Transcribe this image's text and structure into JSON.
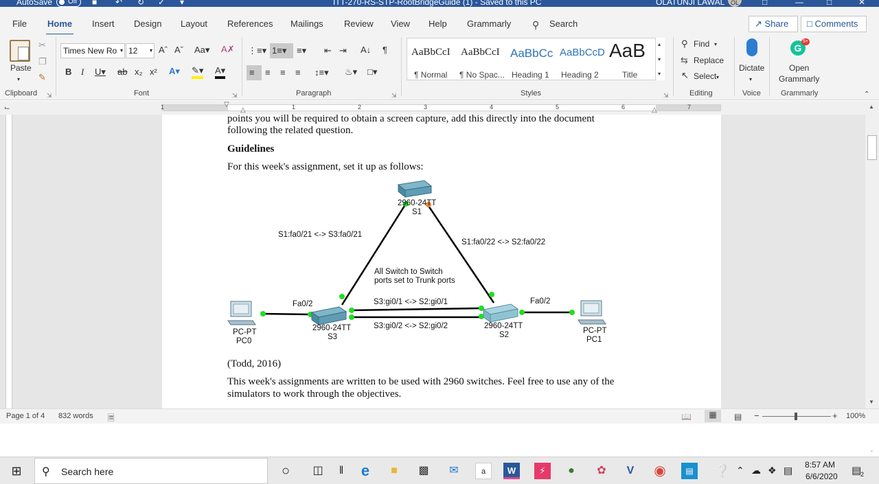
{
  "titlebar": {
    "autosave_label": "AutoSave",
    "autosave_state": "Off",
    "doc_title": "ITT-270-RS-STP-RootBridgeGuide (1)  -  Saved to this PC",
    "user_name": "OLATUNJI LAWAL",
    "user_initials": "OL"
  },
  "tabs": [
    "File",
    "Home",
    "Insert",
    "Design",
    "Layout",
    "References",
    "Mailings",
    "Review",
    "View",
    "Help",
    "Grammarly"
  ],
  "search": {
    "label": "Search"
  },
  "share_label": "Share",
  "comments_label": "Comments",
  "ribbon": {
    "clipboard": {
      "paste_label": "Paste",
      "group_label": "Clipboard"
    },
    "font": {
      "font_name": "Times New Ro",
      "font_size": "12",
      "group_label": "Font"
    },
    "paragraph": {
      "group_label": "Paragraph"
    },
    "styles": {
      "group_label": "Styles",
      "items": [
        {
          "preview": "AaBbCcI",
          "name": "¶ Normal"
        },
        {
          "preview": "AaBbCcI",
          "name": "¶ No Spac..."
        },
        {
          "preview": "AaBbCc",
          "name": "Heading 1"
        },
        {
          "preview": "AaBbCcD",
          "name": "Heading 2"
        },
        {
          "preview": "AaB",
          "name": "Title"
        }
      ]
    },
    "editing": {
      "find_label": "Find",
      "replace_label": "Replace",
      "select_label": "Select",
      "group_label": "Editing"
    },
    "voice": {
      "dictate_label": "Dictate",
      "group_label": "Voice"
    },
    "grammarly": {
      "open_line1": "Open",
      "open_line2": "Grammarly",
      "badge": "5+",
      "group_label": "Grammarly"
    }
  },
  "ruler_numbers": [
    "1",
    "1",
    "2",
    "3",
    "4",
    "5",
    "6",
    "7"
  ],
  "document": {
    "line_cut": "points you will be required to obtain a screen capture, add this directly into the document",
    "line_following": "following the related question.",
    "heading": "Guidelines",
    "intro": "For this week's assignment, set it up as follows:",
    "citation": "(Todd, 2016)",
    "body_line1": "This week's assignments are written to be used with 2960 switches. Feel free to use any of the",
    "body_line2": "simulators to work through the objectives."
  },
  "diagram": {
    "s1_model": "2960-24TT",
    "s1_name": "S1",
    "s2_model": "2960-24TT",
    "s2_name": "S2",
    "s3_model": "2960-24TT",
    "s3_name": "S3",
    "pc0_type": "PC-PT",
    "pc0_name": "PC0",
    "pc1_type": "PC-PT",
    "pc1_name": "PC1",
    "link_s1_s3": "S1:fa0/21 <-> S3:fa0/21",
    "link_s1_s2": "S1:fa0/22 <-> S2:fa0/22",
    "note_line1": "All Switch to Switch",
    "note_line2": "ports set to Trunk ports",
    "link_gi1": "S3:gi0/1 <-> S2:gi0/1",
    "link_gi2": "S3:gi0/2 <-> S2:gi0/2",
    "pc0_port": "Fa0/2",
    "pc1_port": "Fa0/2"
  },
  "statusbar": {
    "page": "Page 1 of 4",
    "words": "832 words",
    "zoom": "100%"
  },
  "taskbar": {
    "search_placeholder": "Search here",
    "time": "8:57 AM",
    "date": "6/6/2020",
    "notif_count": "2"
  },
  "colors": {
    "word_blue": "#2b579a",
    "link_green": "#22dd22",
    "link_orange": "#f08030"
  }
}
